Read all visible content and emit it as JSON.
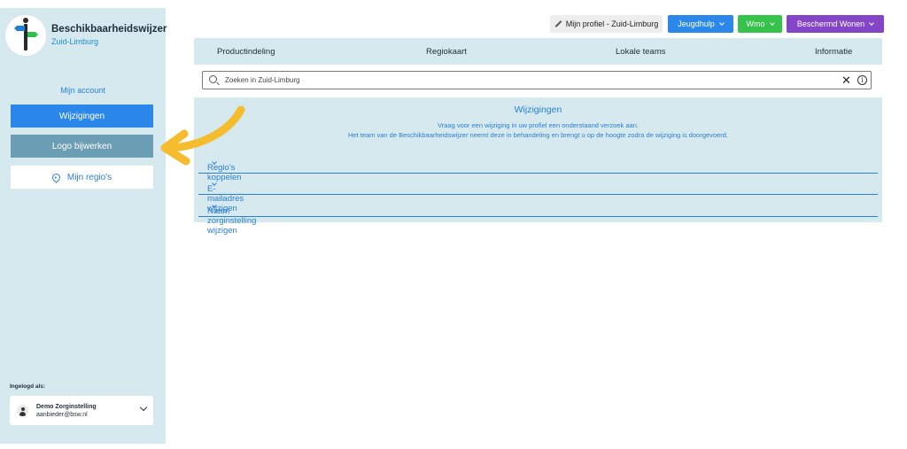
{
  "sidebar": {
    "brand_title": "Beschikbaarheidswijzer",
    "brand_sub": "Zuid-Limburg",
    "my_account": "Mijn account",
    "buttons": {
      "wijzigingen": "Wijzigingen",
      "logo": "Logo bijwerken",
      "regios": "Mijn regio's"
    },
    "login_label": "Ingelogd als:",
    "user": {
      "name": "Demo Zorginstelling",
      "email": "aanbieder@bsw.nl"
    }
  },
  "topbar": {
    "profiel": "Mijn profiel - Zuid-Limburg",
    "jeugdhulp": "Jeugdhulp",
    "wmo": "Wmo",
    "wonen": "Beschermd Wonen"
  },
  "nav": {
    "items": [
      "Productindeling",
      "Regiokaart",
      "Lokale teams",
      "Informatie"
    ]
  },
  "search": {
    "placeholder": "Zoeken in Zuid-Limburg",
    "clear": "✕",
    "info": "i"
  },
  "panel": {
    "title": "Wijzigingen",
    "line1": "Vraag voor een wijziging in uw profiel een onderstaand verzoek aan.",
    "line2": "Het team van de Beschikbaarheidswijzer neemt deze in behandeling en brengt u op de hoogte zodra de wijziging is doorgevoerd.",
    "accordions": [
      "Regio's koppelen",
      "E-mailadres wijzigen",
      "Naam zorginstelling wijzigen"
    ]
  },
  "colors": {
    "sidebar_bg": "#d6e9ef",
    "primary": "#2b88ea",
    "active": "#6b9eb4",
    "wmo": "#35c34c",
    "wonen": "#8545c7",
    "annotation_arrow": "#f5bd2e"
  }
}
